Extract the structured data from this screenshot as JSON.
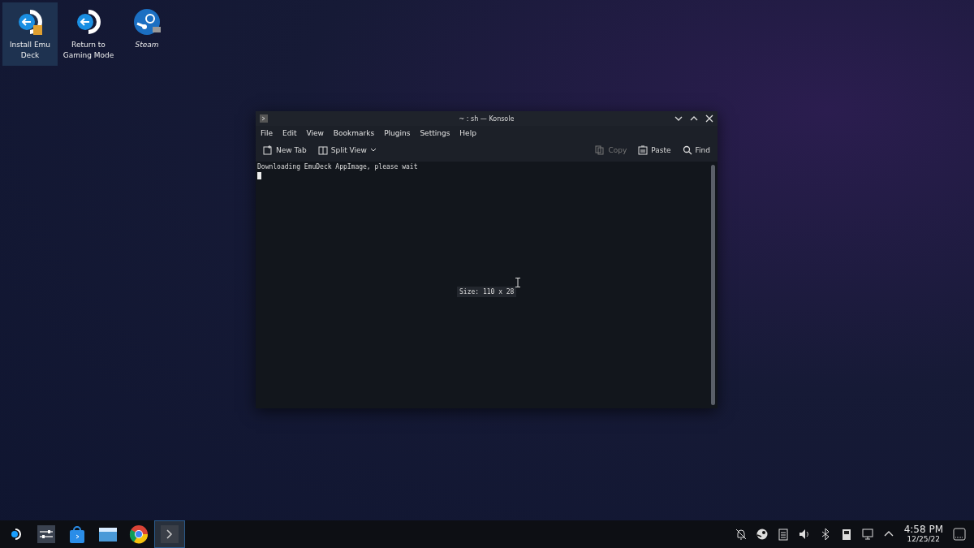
{
  "desktop_icons": [
    {
      "label": "Install Emu Deck",
      "kind": "emudeck",
      "selected": true
    },
    {
      "label": "Return to Gaming Mode",
      "kind": "return",
      "selected": false
    },
    {
      "label": "Steam",
      "kind": "steam",
      "selected": false
    }
  ],
  "window": {
    "title": "~ : sh — Konsole",
    "menu": [
      "File",
      "Edit",
      "View",
      "Bookmarks",
      "Plugins",
      "Settings",
      "Help"
    ],
    "toolbar": [
      {
        "label": "New Tab",
        "kind": "newtab",
        "disabled": false
      },
      {
        "label": "Split View",
        "kind": "split",
        "disabled": false
      },
      {
        "label": "Copy",
        "kind": "copy",
        "disabled": true
      },
      {
        "label": "Paste",
        "kind": "paste",
        "disabled": false
      },
      {
        "label": "Find",
        "kind": "find",
        "disabled": false
      }
    ],
    "terminal_lines": [
      "Downloading EmuDeck AppImage, please wait"
    ],
    "size_tooltip": "Size: 110 x 28"
  },
  "taskbar": {
    "apps": [
      {
        "kind": "steam",
        "selected": false
      },
      {
        "kind": "settings",
        "selected": false
      },
      {
        "kind": "store",
        "selected": false
      },
      {
        "kind": "files",
        "selected": false
      },
      {
        "kind": "browser",
        "selected": false
      },
      {
        "kind": "terminal",
        "selected": true
      }
    ],
    "tray": [
      {
        "kind": "notifications"
      },
      {
        "kind": "steam"
      },
      {
        "kind": "clipboard"
      },
      {
        "kind": "volume"
      },
      {
        "kind": "bluetooth"
      },
      {
        "kind": "storage"
      },
      {
        "kind": "network"
      },
      {
        "kind": "expand"
      }
    ],
    "time": "4:58 PM",
    "date": "12/25/22"
  }
}
